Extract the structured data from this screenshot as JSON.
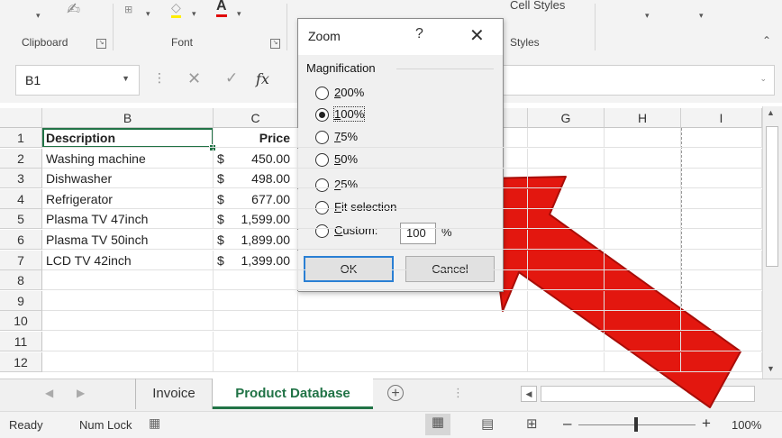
{
  "ribbon": {
    "groups": [
      "Clipboard",
      "Font",
      "Styles"
    ],
    "cell_styles_label": "Cell Styles"
  },
  "formula_bar": {
    "name_box": "B1",
    "fx": "fx",
    "value": ""
  },
  "columns": [
    "B",
    "C",
    "G",
    "H",
    "I"
  ],
  "rows": [
    {
      "num": "1",
      "description": "Description",
      "price_cur": "",
      "price": "Price"
    },
    {
      "num": "2",
      "description": "Washing machine",
      "price_cur": "$",
      "price": "450.00"
    },
    {
      "num": "3",
      "description": "Dishwasher",
      "price_cur": "$",
      "price": "498.00"
    },
    {
      "num": "4",
      "description": "Refrigerator",
      "price_cur": "$",
      "price": "677.00"
    },
    {
      "num": "5",
      "description": "Plasma TV 47inch",
      "price_cur": "$",
      "price": "1,599.00"
    },
    {
      "num": "6",
      "description": "Plasma TV 50inch",
      "price_cur": "$",
      "price": "1,899.00"
    },
    {
      "num": "7",
      "description": "LCD TV 42inch",
      "price_cur": "$",
      "price": "1,399.00"
    },
    {
      "num": "8"
    },
    {
      "num": "9"
    },
    {
      "num": "10"
    },
    {
      "num": "11"
    },
    {
      "num": "12"
    }
  ],
  "sheet_tabs": {
    "tabs": [
      "Invoice",
      "Product Database"
    ],
    "active": "Product Database"
  },
  "status_bar": {
    "ready": "Ready",
    "num_lock": "Num Lock",
    "zoom": "100%"
  },
  "dialog": {
    "title": "Zoom",
    "help": "?",
    "close": "✕",
    "group_label": "Magnification",
    "options": [
      {
        "first": "2",
        "rest": "00%",
        "selected": false
      },
      {
        "first": "1",
        "rest": "00%",
        "selected": true
      },
      {
        "first": "7",
        "rest": "5%",
        "selected": false
      },
      {
        "first": "5",
        "rest": "0%",
        "selected": false
      },
      {
        "first": "2",
        "rest": "5%",
        "selected": false
      },
      {
        "first": "F",
        "rest": "it selection",
        "selected": false
      },
      {
        "first": "C",
        "rest": "ustom:",
        "selected": false
      }
    ],
    "custom_value": "100",
    "custom_unit": "%",
    "ok_label": "OK",
    "cancel_label": "Cancel"
  },
  "colors": {
    "excel_green": "#217346",
    "arrow_red": "#e3170f",
    "ok_border": "#2a7fd4"
  }
}
